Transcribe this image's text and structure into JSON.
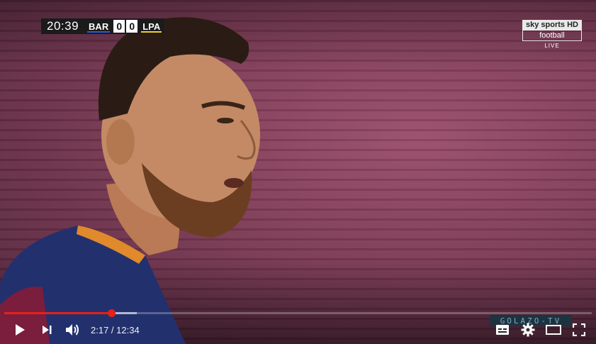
{
  "scorebug": {
    "clock": "20:39",
    "home_team": "BAR",
    "home_score": "0",
    "away_score": "0",
    "away_team": "LPA"
  },
  "broadcaster": {
    "top": "sky sports HD",
    "middle": "football",
    "status": "LIVE"
  },
  "watermark": "GOLAZO-TV",
  "player": {
    "current_time": "2:17",
    "separator": " / ",
    "duration": "12:34",
    "progress_fraction": 0.182,
    "buffered_fraction": 0.226,
    "colors": {
      "played": "#e62117"
    },
    "icons": [
      "play-icon",
      "next-icon",
      "volume-icon",
      "subtitles-icon",
      "settings-icon",
      "theater-mode-icon",
      "fullscreen-icon"
    ]
  }
}
